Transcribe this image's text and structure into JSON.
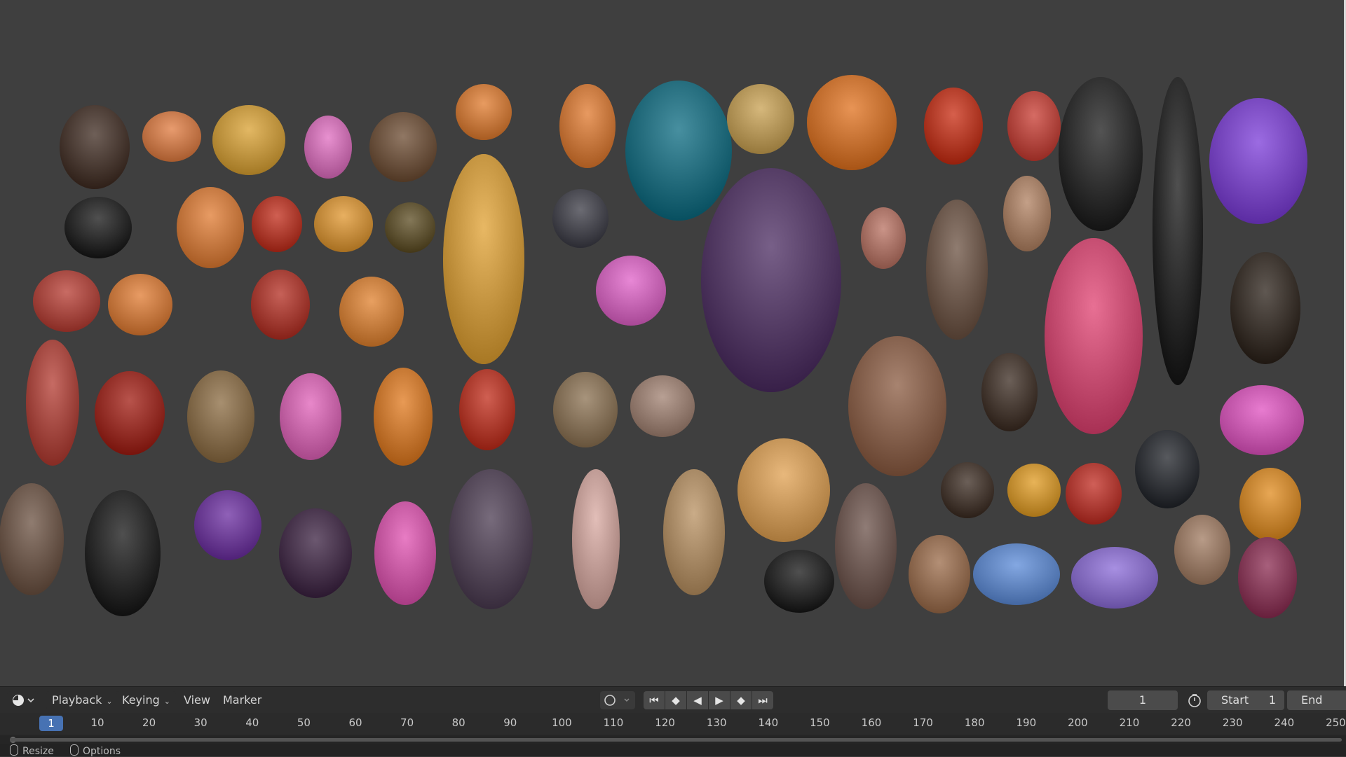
{
  "timeline": {
    "menus": [
      {
        "label": "Playback"
      },
      {
        "label": "Keying"
      },
      {
        "label": "View"
      },
      {
        "label": "Marker"
      }
    ],
    "current_frame": "1",
    "start_label": "Start",
    "start_value": "1",
    "end_label": "End",
    "ruler_ticks": [
      "10",
      "20",
      "30",
      "40",
      "50",
      "60",
      "70",
      "80",
      "90",
      "100",
      "110",
      "120",
      "130",
      "140",
      "150",
      "160",
      "170",
      "180",
      "190",
      "200",
      "210",
      "220",
      "230",
      "240",
      "250"
    ],
    "playhead": "1",
    "transport_icons": [
      "jump-start-icon",
      "prev-keyframe-icon",
      "play-reverse-icon",
      "play-icon",
      "next-keyframe-icon",
      "jump-end-icon"
    ]
  },
  "statusbar": {
    "resize_label": "Resize",
    "options_label": "Options"
  },
  "colors": {
    "viewport_bg": "#3f3f3f",
    "playhead": "#4772b3",
    "header_bg": "#2d2d2d"
  }
}
